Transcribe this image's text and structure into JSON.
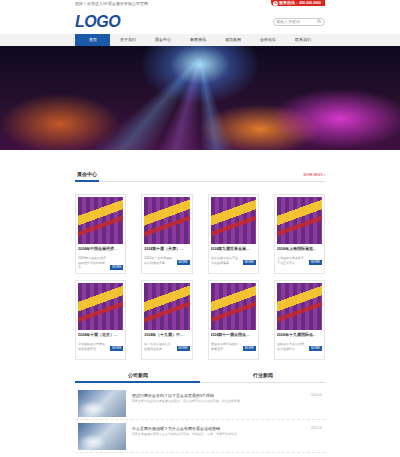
{
  "topbar": {
    "welcome": "您好！欢迎进入XX展会服务有限公司官网",
    "hotline": "服务热线：400-000-0000"
  },
  "logo": "LOGO",
  "search": {
    "placeholder": "请输入关键词"
  },
  "nav": [
    {
      "label": "首页",
      "selected": true
    },
    {
      "label": "关于我们",
      "selected": false
    },
    {
      "label": "展会中心",
      "selected": false
    },
    {
      "label": "新闻资讯",
      "selected": false
    },
    {
      "label": "成功案例",
      "selected": false
    },
    {
      "label": "合作伙伴",
      "selected": false
    },
    {
      "label": "联系我们",
      "selected": false
    }
  ],
  "section": {
    "title": "展会中心",
    "more": "MORE NEWS >"
  },
  "cards": [
    {
      "title": "2024年中国会展经济...",
      "desc": "2024年中国会展经济国际合作论坛即将举办",
      "button": "MORE"
    },
    {
      "title": "2024第十届（天津）...",
      "desc": "2024第十届天津国际会展博览会开幕",
      "button": "MORE"
    },
    {
      "title": "2024第九届世界会展...",
      "desc": "第九届世界会展产业大会圆满落幕",
      "button": "MORE"
    },
    {
      "title": "2024年上海国际展览...",
      "desc": "上海国际展览会将于下月正式开展",
      "button": "MORE"
    },
    {
      "title": "2024年十届（北京）...",
      "desc": "北京国际会展博览会报名通道开启",
      "button": "MORE"
    },
    {
      "title": "2024年（十九届）中...",
      "desc": "第十九届中国会展论坛邀请函发布",
      "button": "MORE"
    },
    {
      "title": "2024第十一届全国会...",
      "desc": "全国会展研讨会在京隆重召开",
      "button": "MORE"
    },
    {
      "title": "2024年十九届国际会...",
      "desc": "国际会展大会展位预定火热进行中",
      "button": "MORE"
    }
  ],
  "news": {
    "tabs": [
      {
        "label": "公司新闻",
        "selected": true
      },
      {
        "label": "行业新闻",
        "selected": false
      }
    ],
    "items": [
      {
        "title": "想进行商务会务吗？以下是会议发展的5个理由",
        "desc": "商务会务对企业发展有着重要的意义，通过会务可以展示企业形象、拓展业务渠道",
        "date": "2024-05"
      },
      {
        "title": "什么是商务旅游呢？为什么会有商务展会活动营销",
        "desc": "商务旅游是指以商务为主要目的的旅行活动，包括会议、展览、考察等多种形式",
        "date": "2024-05"
      }
    ]
  }
}
